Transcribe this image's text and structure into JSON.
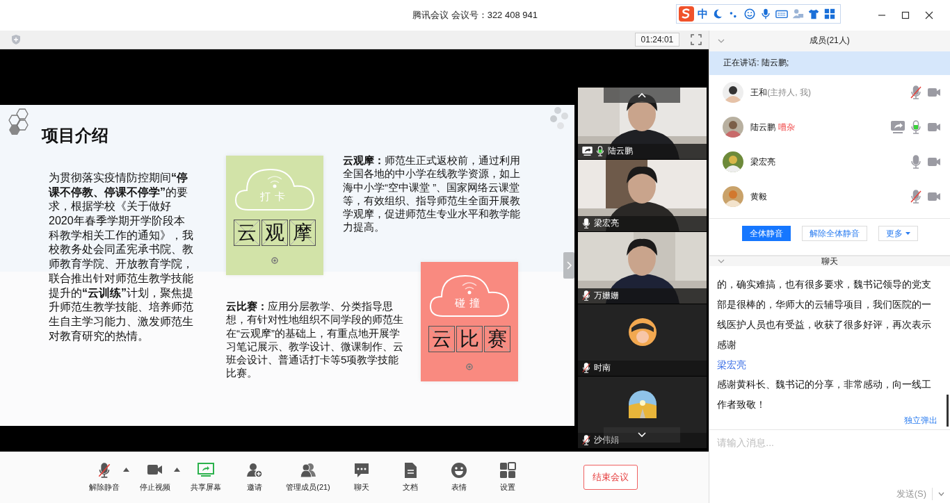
{
  "window": {
    "title": "腾讯会议 会议号：322 408 941"
  },
  "ime_bar": {
    "mode": "中"
  },
  "meeting_bar": {
    "timer": "01:24:01"
  },
  "slide": {
    "title": "项目介绍",
    "intro": "为贯彻落实疫情防控期间**“停课不停教、停课不停学”**的要求，根据学校《关于做好2020年春季学期开学阶段本科教学相关工作的通知》，我校教务处会同孟宪承书院、教师教育学院、开放教育学院，联合推出针对师范生教学技能提升的**“云训练”**计划，聚焦提升师范生教学技能、培养师范生自主学习能力、激发师范生对教育研究的热情。",
    "cards": [
      {
        "label": "打卡",
        "characters": [
          "云",
          "观",
          "摩"
        ],
        "color": "#d2e3a8"
      },
      {
        "label": "碰撞",
        "characters": [
          "云",
          "比",
          "赛"
        ],
        "color": "#f98a80"
      }
    ],
    "descriptions": [
      "**云观摩：**师范生正式返校前，通过利用全国各地的中小学在线教学资源，如上海中小学“空中课堂 ”、国家网络云课堂等，有效组织、指导师范生全面开展教学观摩，促进师范生专业水平和教学能力提高。",
      "**云比赛：**应用分层教学、分类指导思想，有针对性地组织不同学段的师范生在“云观摩”的基础上，有重点地开展学习笔记展示、教学设计、微课制作、云班会设计、普通话打卡等5项教学技能比赛。"
    ]
  },
  "video_tiles": [
    {
      "name": "陆云鹏",
      "kind": "video",
      "muted": false,
      "speaking": true,
      "sharing": true
    },
    {
      "name": "梁宏亮",
      "kind": "video",
      "muted": false,
      "speaking": false,
      "sharing": false
    },
    {
      "name": "万姗姗",
      "kind": "video",
      "muted": true,
      "sharing": false
    },
    {
      "name": "时南",
      "kind": "avatar",
      "muted": true,
      "sharing": false
    },
    {
      "name": "沙伟娟",
      "kind": "avatar",
      "muted": true,
      "sharing": false
    }
  ],
  "members": {
    "title": "成员(21人)",
    "speaking": "正在讲话: 陆云鹏;",
    "list": [
      {
        "name": "王和",
        "note": "(主持人, 我)",
        "kind": "host",
        "muted": true,
        "sharing": false
      },
      {
        "name": "陆云鹏",
        "note": "嘈杂",
        "kind": "warning",
        "muted": false,
        "speaking": true,
        "sharing": true
      },
      {
        "name": "梁宏亮",
        "muted": false,
        "speaking": false,
        "sharing": false
      },
      {
        "name": "黄毅",
        "muted": true,
        "sharing": false
      }
    ],
    "buttons": [
      {
        "label": "全体静音",
        "kind": "primary"
      },
      {
        "label": "解除全体静音",
        "kind": "outline"
      },
      {
        "label": "更多",
        "kind": "menu"
      }
    ]
  },
  "chat": {
    "title": "聊天",
    "messages": [
      {
        "text": "的，确实难搞，也有很多要求，魏书记领导的党支部是很棒的，华师大的云辅导项目，我们医院的一线医护人员也有受益，收获了很多好评，再次表示感谢"
      },
      {
        "sender": "梁宏亮",
        "text": "感谢黄科长、魏书记的分享，非常感动，向一线工作者致敬！"
      }
    ],
    "popout": "独立弹出",
    "input": {
      "placeholder": "请输入消息..."
    },
    "send": "发送(S)"
  },
  "toolbar": {
    "items": [
      {
        "kind": "mic",
        "label": "解除静音",
        "menu": true
      },
      {
        "kind": "camera",
        "label": "停止视频",
        "menu": true
      },
      {
        "kind": "share",
        "label": "共享屏幕",
        "menu": false
      },
      {
        "kind": "invite",
        "label": "邀请",
        "menu": false
      },
      {
        "kind": "members",
        "label": "管理成员(21)",
        "menu": false
      },
      {
        "kind": "chat",
        "label": "聊天",
        "menu": false
      },
      {
        "kind": "doc",
        "label": "文档",
        "menu": false
      },
      {
        "kind": "emoji",
        "label": "表情",
        "menu": false
      },
      {
        "kind": "settings",
        "label": "设置",
        "menu": false
      }
    ],
    "end_button": "结束会议"
  }
}
